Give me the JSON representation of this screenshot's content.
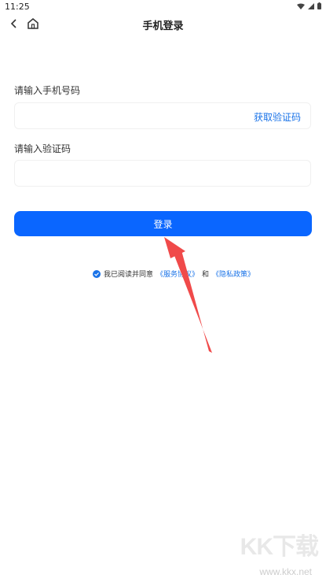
{
  "status_bar": {
    "time": "11:25",
    "icons": [
      "wifi-icon",
      "signal-icon",
      "battery-icon"
    ]
  },
  "nav": {
    "title": "手机登录",
    "icons": [
      "back-icon",
      "home-icon"
    ]
  },
  "phone": {
    "label": "请输入手机号码",
    "value": "",
    "get_code_label": "获取验证码"
  },
  "code": {
    "label": "请输入验证码",
    "value": ""
  },
  "login": {
    "button_label": "登录"
  },
  "agreement": {
    "prefix": "我已阅读并同意",
    "service_link": "《服务协议》",
    "and": "和",
    "privacy_link": "《隐私政策》",
    "checked": true
  },
  "watermark": {
    "brand": "KK下载",
    "url": "www.kkx.net"
  },
  "colors": {
    "accent": "#0a66ff",
    "link": "#1a73e8",
    "annotation_arrow": "#f04a4a"
  }
}
